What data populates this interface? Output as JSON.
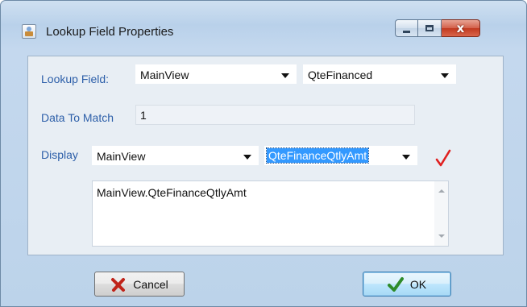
{
  "window": {
    "title": "Lookup Field Properties",
    "controls": {
      "minimize": "minimize",
      "maximize": "maximize",
      "close": "x"
    }
  },
  "lookup_field": {
    "label": "Lookup Field:",
    "view_value": "MainView",
    "field_value": "QteFinanced"
  },
  "data_to_match": {
    "label": "Data To Match",
    "value": "1"
  },
  "display": {
    "label": "Display",
    "view_value": "MainView",
    "field_value": "QteFinanceQtlyAmt",
    "valid_icon": "checkmark-icon",
    "valid_color": "#e02020"
  },
  "expression": {
    "text": "MainView.QteFinanceQtlyAmt"
  },
  "buttons": {
    "cancel_label": "Cancel",
    "ok_label": "OK"
  },
  "colors": {
    "label_blue": "#2d5fa9",
    "selection": "#3399ff"
  }
}
